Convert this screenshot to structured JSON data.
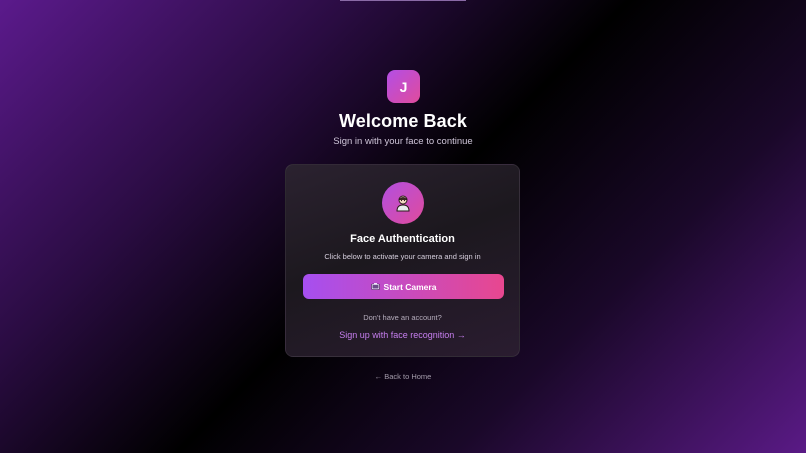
{
  "brand": {
    "logo_letter": "J",
    "accent_start": "#b34ee6",
    "accent_end": "#e04b9c"
  },
  "header": {
    "title": "Welcome Back",
    "subtitle": "Sign in with your face to continue"
  },
  "card": {
    "icon": "person-icon",
    "title": "Face Authentication",
    "description": "Click below to activate your camera and sign in",
    "start_button_icon": "camera-icon",
    "start_button_label": "Start Camera",
    "no_account_text": "Don't have an account?",
    "signup_link_label": "Sign up with face recognition →"
  },
  "footer": {
    "back_link_label": "← Back to Home"
  }
}
